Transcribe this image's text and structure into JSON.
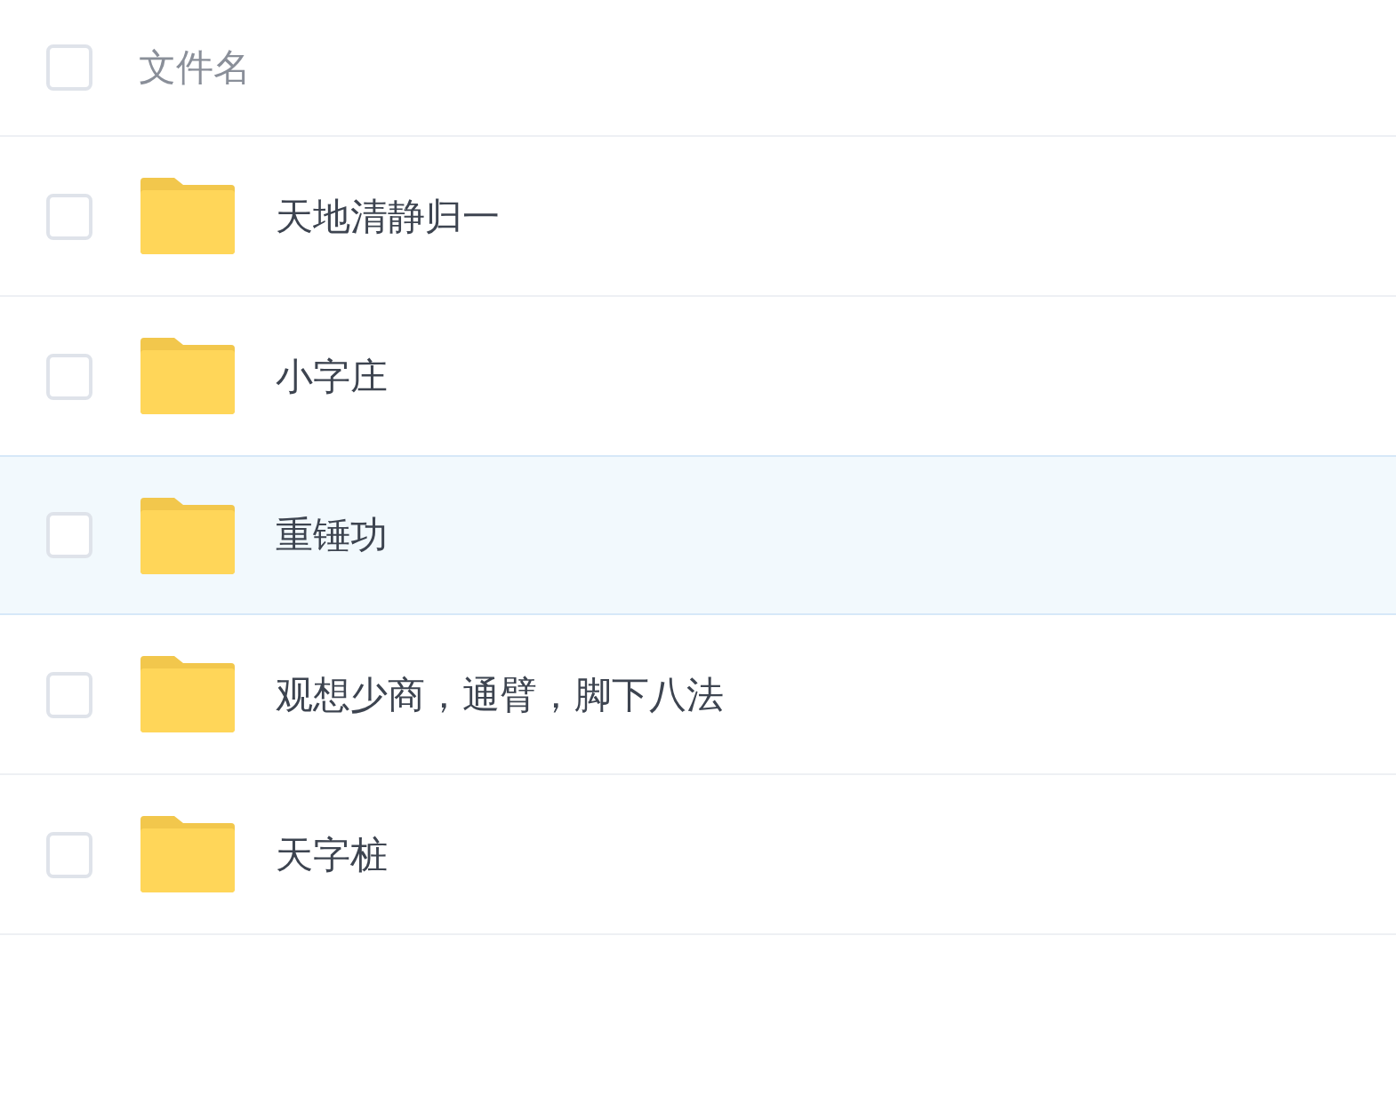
{
  "header": {
    "checked": false,
    "label": "文件名"
  },
  "rows": [
    {
      "name": "天地清静归一",
      "checked": false,
      "selected": false
    },
    {
      "name": "小字庄",
      "checked": false,
      "selected": false
    },
    {
      "name": "重锤功",
      "checked": false,
      "selected": true
    },
    {
      "name": "观想少商，通臂，脚下八法",
      "checked": false,
      "selected": false
    },
    {
      "name": "天字桩",
      "checked": false,
      "selected": false
    }
  ]
}
